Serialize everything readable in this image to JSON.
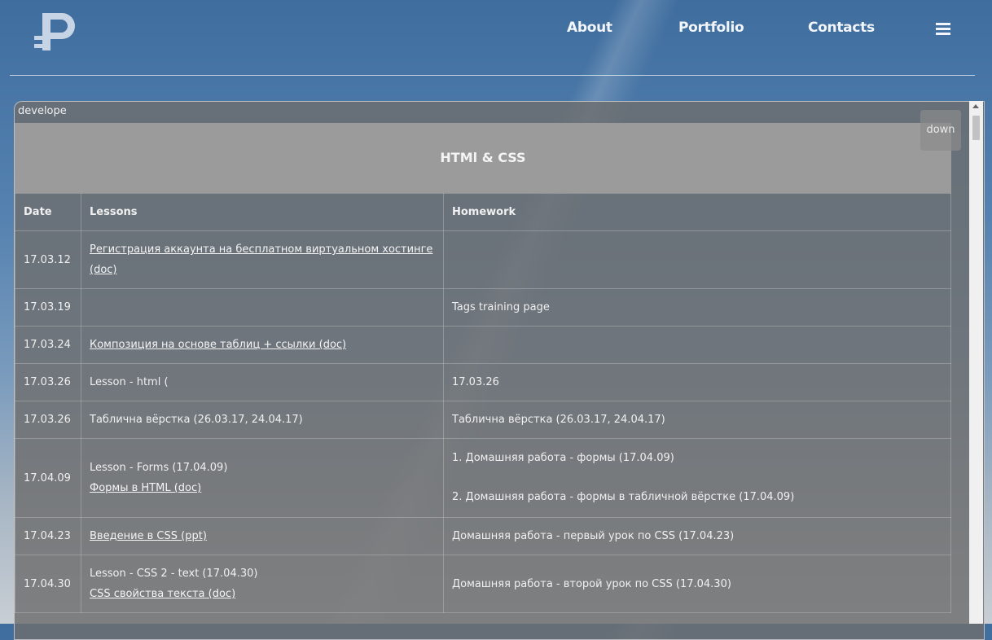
{
  "nav": {
    "about": "About",
    "portfolio": "Portfolio",
    "contacts": "Contacts",
    "menu_icon": "hamburger-icon"
  },
  "logo": {
    "icon": "logo-p-icon",
    "color": "#c7d4e6"
  },
  "panel": {
    "title": "develope",
    "down_label": "down",
    "table_title": "HTMl & CSS",
    "columns": [
      "Date",
      "Lessons",
      "Homework"
    ],
    "rows": [
      {
        "date": "17.03.12",
        "lessons": [
          {
            "text": "Регистрация аккаунта на бесплатном виртуальном хостинге (doc)",
            "link": true
          }
        ],
        "homework": []
      },
      {
        "date": "17.03.19",
        "lessons": [],
        "homework": [
          "Tags training page"
        ]
      },
      {
        "date": "17.03.24",
        "lessons": [
          {
            "text": "Композиция на основе таблиц + ссылки (doc)",
            "link": true
          }
        ],
        "homework": []
      },
      {
        "date": "17.03.26",
        "lessons": [
          {
            "text": "Lesson - html (",
            "link": false
          }
        ],
        "homework": [
          "17.03.26"
        ]
      },
      {
        "date": "17.03.26",
        "lessons": [
          {
            "text": "Таблична вёрстка (26.03.17, 24.04.17)",
            "link": false
          }
        ],
        "homework": [
          "Таблична вёрстка (26.03.17, 24.04.17)"
        ]
      },
      {
        "date": "17.04.09",
        "lessons": [
          {
            "text": "Lesson - Forms (17.04.09)",
            "link": false
          },
          {
            "text": "Формы в HTML (doc)",
            "link": true
          }
        ],
        "homework": [
          "1. Домашняя работа - формы (17.04.09)",
          "2. Домашняя работа - формы в табличной вёрстке (17.04.09)"
        ]
      },
      {
        "date": "17.04.23",
        "lessons": [
          {
            "text": "Введение в CSS (ppt)",
            "link": true
          }
        ],
        "homework": [
          "Домашняя работа - первый урок по CSS (17.04.23)"
        ]
      },
      {
        "date": "17.04.30",
        "lessons": [
          {
            "text": "Lesson - CSS 2 - text (17.04.30)",
            "link": false
          },
          {
            "text": "CSS свойства текста (doc)",
            "link": true
          }
        ],
        "homework": [
          "Домашняя работа - второй урок по CSS (17.04.30)"
        ]
      }
    ]
  }
}
